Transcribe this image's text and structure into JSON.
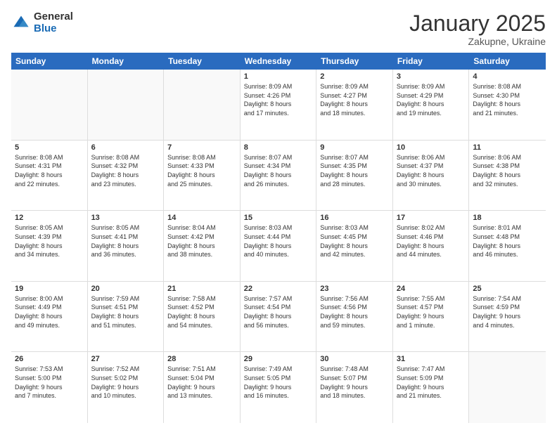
{
  "logo": {
    "general": "General",
    "blue": "Blue"
  },
  "header": {
    "month": "January 2025",
    "location": "Zakupne, Ukraine"
  },
  "weekdays": [
    "Sunday",
    "Monday",
    "Tuesday",
    "Wednesday",
    "Thursday",
    "Friday",
    "Saturday"
  ],
  "weeks": [
    [
      {
        "day": "",
        "info": ""
      },
      {
        "day": "",
        "info": ""
      },
      {
        "day": "",
        "info": ""
      },
      {
        "day": "1",
        "info": "Sunrise: 8:09 AM\nSunset: 4:26 PM\nDaylight: 8 hours\nand 17 minutes."
      },
      {
        "day": "2",
        "info": "Sunrise: 8:09 AM\nSunset: 4:27 PM\nDaylight: 8 hours\nand 18 minutes."
      },
      {
        "day": "3",
        "info": "Sunrise: 8:09 AM\nSunset: 4:29 PM\nDaylight: 8 hours\nand 19 minutes."
      },
      {
        "day": "4",
        "info": "Sunrise: 8:08 AM\nSunset: 4:30 PM\nDaylight: 8 hours\nand 21 minutes."
      }
    ],
    [
      {
        "day": "5",
        "info": "Sunrise: 8:08 AM\nSunset: 4:31 PM\nDaylight: 8 hours\nand 22 minutes."
      },
      {
        "day": "6",
        "info": "Sunrise: 8:08 AM\nSunset: 4:32 PM\nDaylight: 8 hours\nand 23 minutes."
      },
      {
        "day": "7",
        "info": "Sunrise: 8:08 AM\nSunset: 4:33 PM\nDaylight: 8 hours\nand 25 minutes."
      },
      {
        "day": "8",
        "info": "Sunrise: 8:07 AM\nSunset: 4:34 PM\nDaylight: 8 hours\nand 26 minutes."
      },
      {
        "day": "9",
        "info": "Sunrise: 8:07 AM\nSunset: 4:35 PM\nDaylight: 8 hours\nand 28 minutes."
      },
      {
        "day": "10",
        "info": "Sunrise: 8:06 AM\nSunset: 4:37 PM\nDaylight: 8 hours\nand 30 minutes."
      },
      {
        "day": "11",
        "info": "Sunrise: 8:06 AM\nSunset: 4:38 PM\nDaylight: 8 hours\nand 32 minutes."
      }
    ],
    [
      {
        "day": "12",
        "info": "Sunrise: 8:05 AM\nSunset: 4:39 PM\nDaylight: 8 hours\nand 34 minutes."
      },
      {
        "day": "13",
        "info": "Sunrise: 8:05 AM\nSunset: 4:41 PM\nDaylight: 8 hours\nand 36 minutes."
      },
      {
        "day": "14",
        "info": "Sunrise: 8:04 AM\nSunset: 4:42 PM\nDaylight: 8 hours\nand 38 minutes."
      },
      {
        "day": "15",
        "info": "Sunrise: 8:03 AM\nSunset: 4:44 PM\nDaylight: 8 hours\nand 40 minutes."
      },
      {
        "day": "16",
        "info": "Sunrise: 8:03 AM\nSunset: 4:45 PM\nDaylight: 8 hours\nand 42 minutes."
      },
      {
        "day": "17",
        "info": "Sunrise: 8:02 AM\nSunset: 4:46 PM\nDaylight: 8 hours\nand 44 minutes."
      },
      {
        "day": "18",
        "info": "Sunrise: 8:01 AM\nSunset: 4:48 PM\nDaylight: 8 hours\nand 46 minutes."
      }
    ],
    [
      {
        "day": "19",
        "info": "Sunrise: 8:00 AM\nSunset: 4:49 PM\nDaylight: 8 hours\nand 49 minutes."
      },
      {
        "day": "20",
        "info": "Sunrise: 7:59 AM\nSunset: 4:51 PM\nDaylight: 8 hours\nand 51 minutes."
      },
      {
        "day": "21",
        "info": "Sunrise: 7:58 AM\nSunset: 4:52 PM\nDaylight: 8 hours\nand 54 minutes."
      },
      {
        "day": "22",
        "info": "Sunrise: 7:57 AM\nSunset: 4:54 PM\nDaylight: 8 hours\nand 56 minutes."
      },
      {
        "day": "23",
        "info": "Sunrise: 7:56 AM\nSunset: 4:56 PM\nDaylight: 8 hours\nand 59 minutes."
      },
      {
        "day": "24",
        "info": "Sunrise: 7:55 AM\nSunset: 4:57 PM\nDaylight: 9 hours\nand 1 minute."
      },
      {
        "day": "25",
        "info": "Sunrise: 7:54 AM\nSunset: 4:59 PM\nDaylight: 9 hours\nand 4 minutes."
      }
    ],
    [
      {
        "day": "26",
        "info": "Sunrise: 7:53 AM\nSunset: 5:00 PM\nDaylight: 9 hours\nand 7 minutes."
      },
      {
        "day": "27",
        "info": "Sunrise: 7:52 AM\nSunset: 5:02 PM\nDaylight: 9 hours\nand 10 minutes."
      },
      {
        "day": "28",
        "info": "Sunrise: 7:51 AM\nSunset: 5:04 PM\nDaylight: 9 hours\nand 13 minutes."
      },
      {
        "day": "29",
        "info": "Sunrise: 7:49 AM\nSunset: 5:05 PM\nDaylight: 9 hours\nand 16 minutes."
      },
      {
        "day": "30",
        "info": "Sunrise: 7:48 AM\nSunset: 5:07 PM\nDaylight: 9 hours\nand 18 minutes."
      },
      {
        "day": "31",
        "info": "Sunrise: 7:47 AM\nSunset: 5:09 PM\nDaylight: 9 hours\nand 21 minutes."
      },
      {
        "day": "",
        "info": ""
      }
    ]
  ]
}
